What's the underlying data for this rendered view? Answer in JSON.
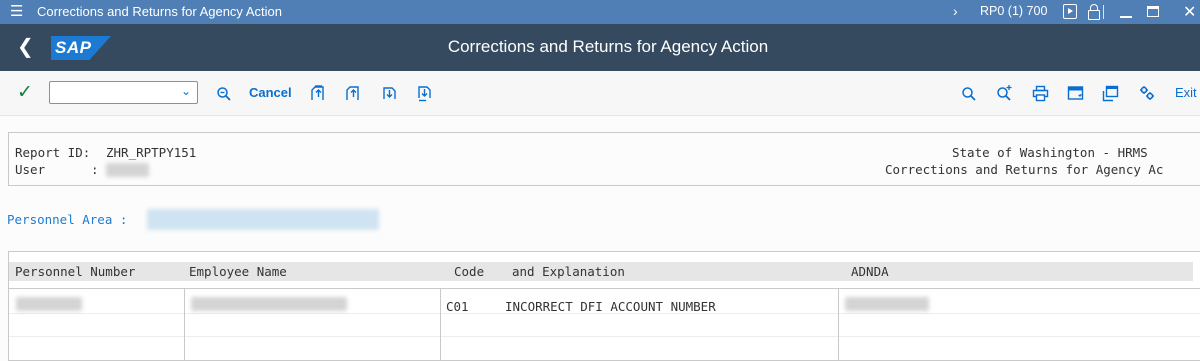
{
  "window": {
    "title": "Corrections and Returns for Agency Action",
    "system_info": "RP0 (1) 700"
  },
  "shell": {
    "title": "Corrections and Returns for Agency Action",
    "logo_text": "SAP"
  },
  "toolbar": {
    "command_field_value": "",
    "cancel_label": "Cancel",
    "exit_label": "Exit",
    "icons": [
      "enter-check-icon",
      "find-icon",
      "first-page-icon",
      "previous-page-icon",
      "next-page-icon",
      "last-page-icon",
      "search-icon",
      "search-next-icon",
      "print-icon",
      "bookmark-icon",
      "export-icon",
      "settings-icon"
    ]
  },
  "report": {
    "report_id_label": "Report ID:",
    "report_id": "ZHR_RPTPY151",
    "user_label": "User",
    "user_sep": ":",
    "org": "State of Washington - HRMS",
    "subtitle": "Corrections and Returns for Agency Ac",
    "personnel_area_label": "Personnel Area :"
  },
  "table": {
    "columns": [
      "Personnel Number",
      "Employee Name",
      "Code",
      "and Explanation",
      "ADNDA"
    ],
    "rows": [
      {
        "code": "C01",
        "explanation": "INCORRECT DFI ACCOUNT NUMBER"
      }
    ]
  },
  "colors": {
    "title_bar": "#4f7fb5",
    "shell_bar": "#354a5f",
    "accent": "#0a6ed1",
    "check": "#107e3e",
    "label_blue": "#1f7bd1"
  }
}
